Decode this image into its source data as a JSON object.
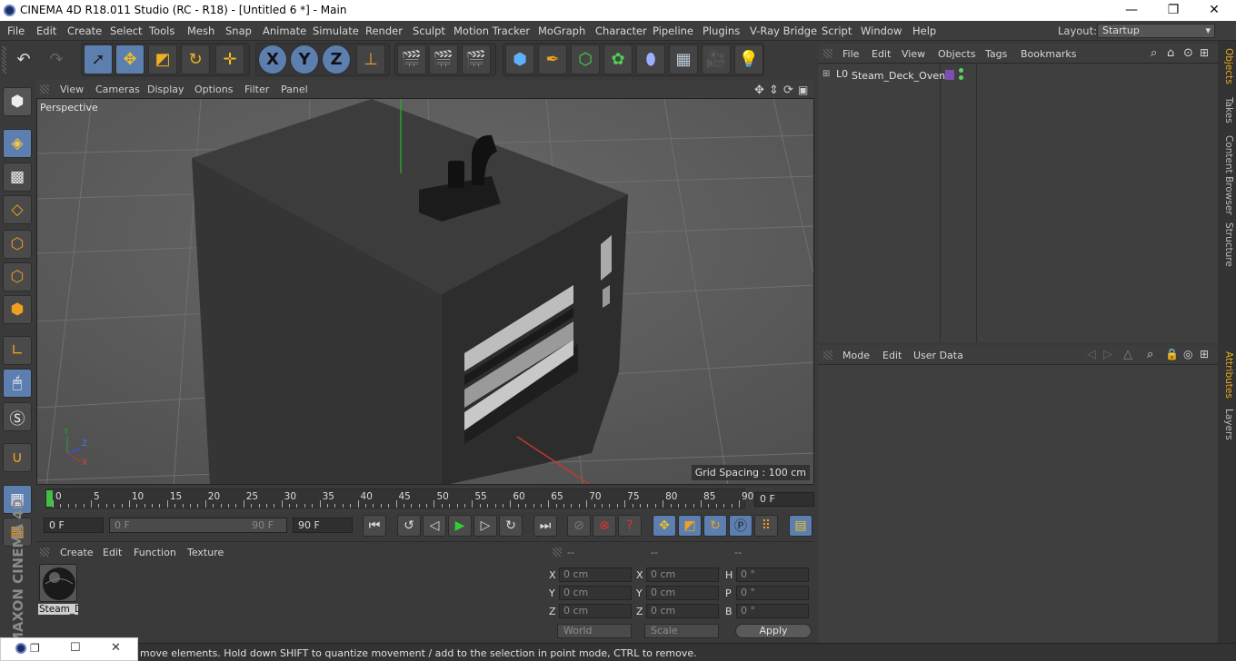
{
  "window": {
    "title": "CINEMA 4D R18.011 Studio (RC - R18) - [Untitled 6 *] - Main",
    "controls": [
      "—",
      "❐",
      "✕"
    ]
  },
  "menu": {
    "items": [
      "File",
      "Edit",
      "Create",
      "Select",
      "Tools",
      "Mesh",
      "Snap",
      "Animate",
      "Simulate",
      "Render",
      "Sculpt",
      "Motion Tracker",
      "MoGraph",
      "Character",
      "Pipeline",
      "Plugins",
      "V-Ray Bridge",
      "Script",
      "Window",
      "Help"
    ],
    "layout_label": "Layout:",
    "layout_value": "Startup"
  },
  "toolbar": {
    "axis": [
      "X",
      "Y",
      "Z"
    ]
  },
  "viewport": {
    "menu": [
      "View",
      "Cameras",
      "Display",
      "Options",
      "Filter",
      "Panel"
    ],
    "camera": "Perspective",
    "grid_spacing": "Grid Spacing : 100 cm",
    "axis_labels": {
      "y": "Y",
      "z": "Z",
      "x": "X"
    }
  },
  "timeline": {
    "ticks": [
      "0",
      "5",
      "10",
      "15",
      "20",
      "25",
      "30",
      "35",
      "40",
      "45",
      "50",
      "55",
      "60",
      "65",
      "70",
      "75",
      "80",
      "85",
      "90"
    ],
    "current_frame": "0 F"
  },
  "transport": {
    "start": "0 F",
    "range_start": "0 F",
    "range_end": "90 F",
    "end": "90 F"
  },
  "materials": {
    "menu": [
      "Create",
      "Edit",
      "Function",
      "Texture"
    ],
    "items": [
      {
        "label": "Steam_D"
      }
    ]
  },
  "coordinates": {
    "headers": [
      "--",
      "--",
      "--"
    ],
    "rows": [
      {
        "l1": "X",
        "v1": "0 cm",
        "l2": "X",
        "v2": "0 cm",
        "l3": "H",
        "v3": "0 °"
      },
      {
        "l1": "Y",
        "v1": "0 cm",
        "l2": "Y",
        "v2": "0 cm",
        "l3": "P",
        "v3": "0 °"
      },
      {
        "l1": "Z",
        "v1": "0 cm",
        "l2": "Z",
        "v2": "0 cm",
        "l3": "B",
        "v3": "0 °"
      }
    ],
    "space": "World",
    "mode": "Scale",
    "apply": "Apply"
  },
  "objects": {
    "menu": [
      "File",
      "Edit",
      "View",
      "Objects",
      "Tags",
      "Bookmarks"
    ],
    "items": [
      {
        "name": "Steam_Deck_Oven"
      }
    ]
  },
  "attributes": {
    "menu": [
      "Mode",
      "Edit",
      "User Data"
    ]
  },
  "side_tabs": [
    "Objects",
    "Takes",
    "Content Browser",
    "Structure",
    "Attributes",
    "Layers"
  ],
  "status": {
    "text": "move elements. Hold down SHIFT to quantize movement / add to the selection in point mode, CTRL to remove."
  },
  "branding": {
    "maxon": "MAXON CINEMA 4D"
  }
}
